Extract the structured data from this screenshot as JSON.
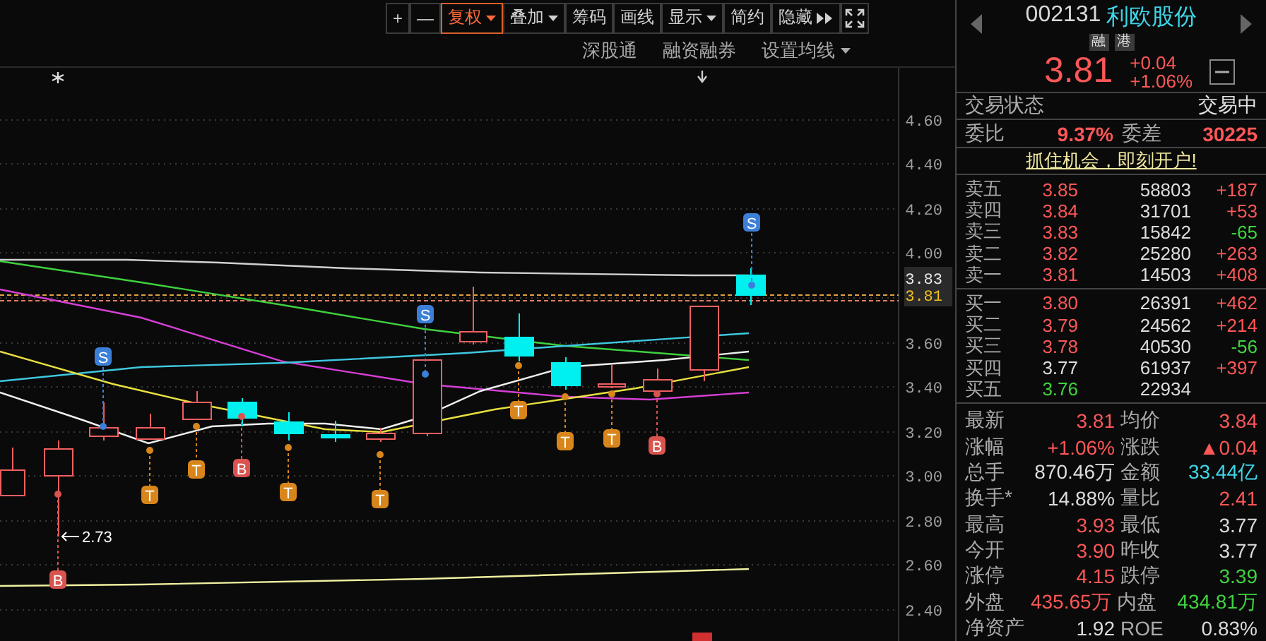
{
  "toolbar": [
    {
      "label": "+",
      "kind": "plain",
      "selected": false
    },
    {
      "label": "—",
      "kind": "plain",
      "selected": false
    },
    {
      "label": "复权",
      "kind": "dropdown",
      "selected": true
    },
    {
      "label": "叠加",
      "kind": "dropdown",
      "selected": false
    },
    {
      "label": "筹码",
      "kind": "plain",
      "selected": false
    },
    {
      "label": "画线",
      "kind": "plain",
      "selected": false
    },
    {
      "label": "显示",
      "kind": "dropdown",
      "selected": false
    },
    {
      "label": "简约",
      "kind": "plain",
      "selected": false
    },
    {
      "label": "隐藏",
      "kind": "more",
      "selected": false
    }
  ],
  "sub_links": [
    {
      "label": "深股通",
      "kind": "plain"
    },
    {
      "label": "融资融券",
      "kind": "plain"
    },
    {
      "label": "设置均线",
      "kind": "dropdown"
    }
  ],
  "chart": {
    "y_axis": [
      "4.60",
      "4.40",
      "4.20",
      "4.00",
      "3.60",
      "3.40",
      "3.20",
      "3.00",
      "2.80",
      "2.60",
      "2.40"
    ],
    "price_tags": [
      {
        "label": "3.83",
        "kind": "high"
      },
      {
        "label": "3.81",
        "kind": "last"
      }
    ],
    "low_label": "2.73",
    "signals": [
      {
        "label": "S",
        "kind": "sell"
      },
      {
        "label": "S",
        "kind": "sell"
      },
      {
        "label": "S",
        "kind": "sell"
      },
      {
        "label": "T",
        "kind": "t"
      },
      {
        "label": "T",
        "kind": "t"
      },
      {
        "label": "T",
        "kind": "t"
      },
      {
        "label": "T",
        "kind": "t"
      },
      {
        "label": "T",
        "kind": "t"
      },
      {
        "label": "T",
        "kind": "t"
      },
      {
        "label": "T",
        "kind": "t"
      },
      {
        "label": "B",
        "kind": "buy"
      },
      {
        "label": "B",
        "kind": "buy"
      },
      {
        "label": "B",
        "kind": "buy"
      }
    ]
  },
  "quote": {
    "code": "002131",
    "name": "利欧股份",
    "tags": [
      "融",
      "港"
    ],
    "price": "3.81",
    "change": "+0.04",
    "change_pct": "+1.06%"
  },
  "status": {
    "label": "交易状态",
    "value": "交易中"
  },
  "commission": [
    {
      "label": "委比",
      "value": "9.37%",
      "color": "#ff5757"
    },
    {
      "label": "委差",
      "value": "30225",
      "color": "#ff5757"
    }
  ],
  "promo_link": "抓住机会，即刻开户!",
  "asks": [
    {
      "label": "卖五",
      "price": {
        "text": "3.85",
        "color": "#ff5757"
      },
      "volume": "58803",
      "change": {
        "text": "+187",
        "color": "#ff5757"
      }
    },
    {
      "label": "卖四",
      "price": {
        "text": "3.84",
        "color": "#ff5757"
      },
      "volume": "31701",
      "change": {
        "text": "+53",
        "color": "#ff5757"
      }
    },
    {
      "label": "卖三",
      "price": {
        "text": "3.83",
        "color": "#ff5757"
      },
      "volume": "15842",
      "change": {
        "text": "-65",
        "color": "#3fd43f"
      }
    },
    {
      "label": "卖二",
      "price": {
        "text": "3.82",
        "color": "#ff5757"
      },
      "volume": "25280",
      "change": {
        "text": "+263",
        "color": "#ff5757"
      }
    },
    {
      "label": "卖一",
      "price": {
        "text": "3.81",
        "color": "#ff5757"
      },
      "volume": "14503",
      "change": {
        "text": "+408",
        "color": "#ff5757"
      }
    }
  ],
  "bids": [
    {
      "label": "买一",
      "price": {
        "text": "3.80",
        "color": "#ff5757"
      },
      "volume": "26391",
      "change": {
        "text": "+462",
        "color": "#ff5757"
      }
    },
    {
      "label": "买二",
      "price": {
        "text": "3.79",
        "color": "#ff5757"
      },
      "volume": "24562",
      "change": {
        "text": "+214",
        "color": "#ff5757"
      }
    },
    {
      "label": "买三",
      "price": {
        "text": "3.78",
        "color": "#ff5757"
      },
      "volume": "40530",
      "change": {
        "text": "-56",
        "color": "#3fd43f"
      }
    },
    {
      "label": "买四",
      "price": {
        "text": "3.77",
        "color": "#dcdcdc"
      },
      "volume": "61937",
      "change": {
        "text": "+397",
        "color": "#ff5757"
      }
    },
    {
      "label": "买五",
      "price": {
        "text": "3.76",
        "color": "#3fd43f"
      },
      "volume": "22934"
    }
  ],
  "stats": [
    [
      {
        "label": "最新",
        "value": "3.81",
        "color": "#ff5757"
      },
      {
        "label": "均价",
        "value": "3.84",
        "color": "#ff5757"
      }
    ],
    [
      {
        "label": "涨幅",
        "value": "+1.06%",
        "color": "#ff5757"
      },
      {
        "label": "涨跌",
        "value": "▲0.04",
        "color": "#ff5757"
      }
    ],
    [
      {
        "label": "总手",
        "value": "870.46万",
        "color": "#dcdcdc"
      },
      {
        "label": "金额",
        "value": "33.44亿",
        "color": "#3fd6e8"
      }
    ],
    [
      {
        "label": "换手*",
        "value": "14.88%",
        "color": "#dcdcdc"
      },
      {
        "label": "量比",
        "value": "2.41",
        "color": "#ff5757"
      }
    ],
    [
      {
        "label": "最高",
        "value": "3.93",
        "color": "#ff5757"
      },
      {
        "label": "最低",
        "value": "3.77",
        "color": "#dcdcdc"
      }
    ],
    [
      {
        "label": "今开",
        "value": "3.90",
        "color": "#ff5757"
      },
      {
        "label": "昨收",
        "value": "3.77",
        "color": "#dcdcdc"
      }
    ],
    [
      {
        "label": "涨停",
        "value": "4.15",
        "color": "#ff5757"
      },
      {
        "label": "跌停",
        "value": "3.39",
        "color": "#3fd43f"
      }
    ],
    [
      {
        "label": "外盘",
        "value": "435.65万",
        "color": "#ff5757"
      },
      {
        "label": "内盘",
        "value": "434.81万",
        "color": "#3fd43f"
      }
    ],
    [
      {
        "label": "净资产",
        "value": "1.92",
        "color": "#dcdcdc"
      },
      {
        "label": "ROE",
        "value": "0.83%",
        "color": "#dcdcdc"
      }
    ]
  ]
}
